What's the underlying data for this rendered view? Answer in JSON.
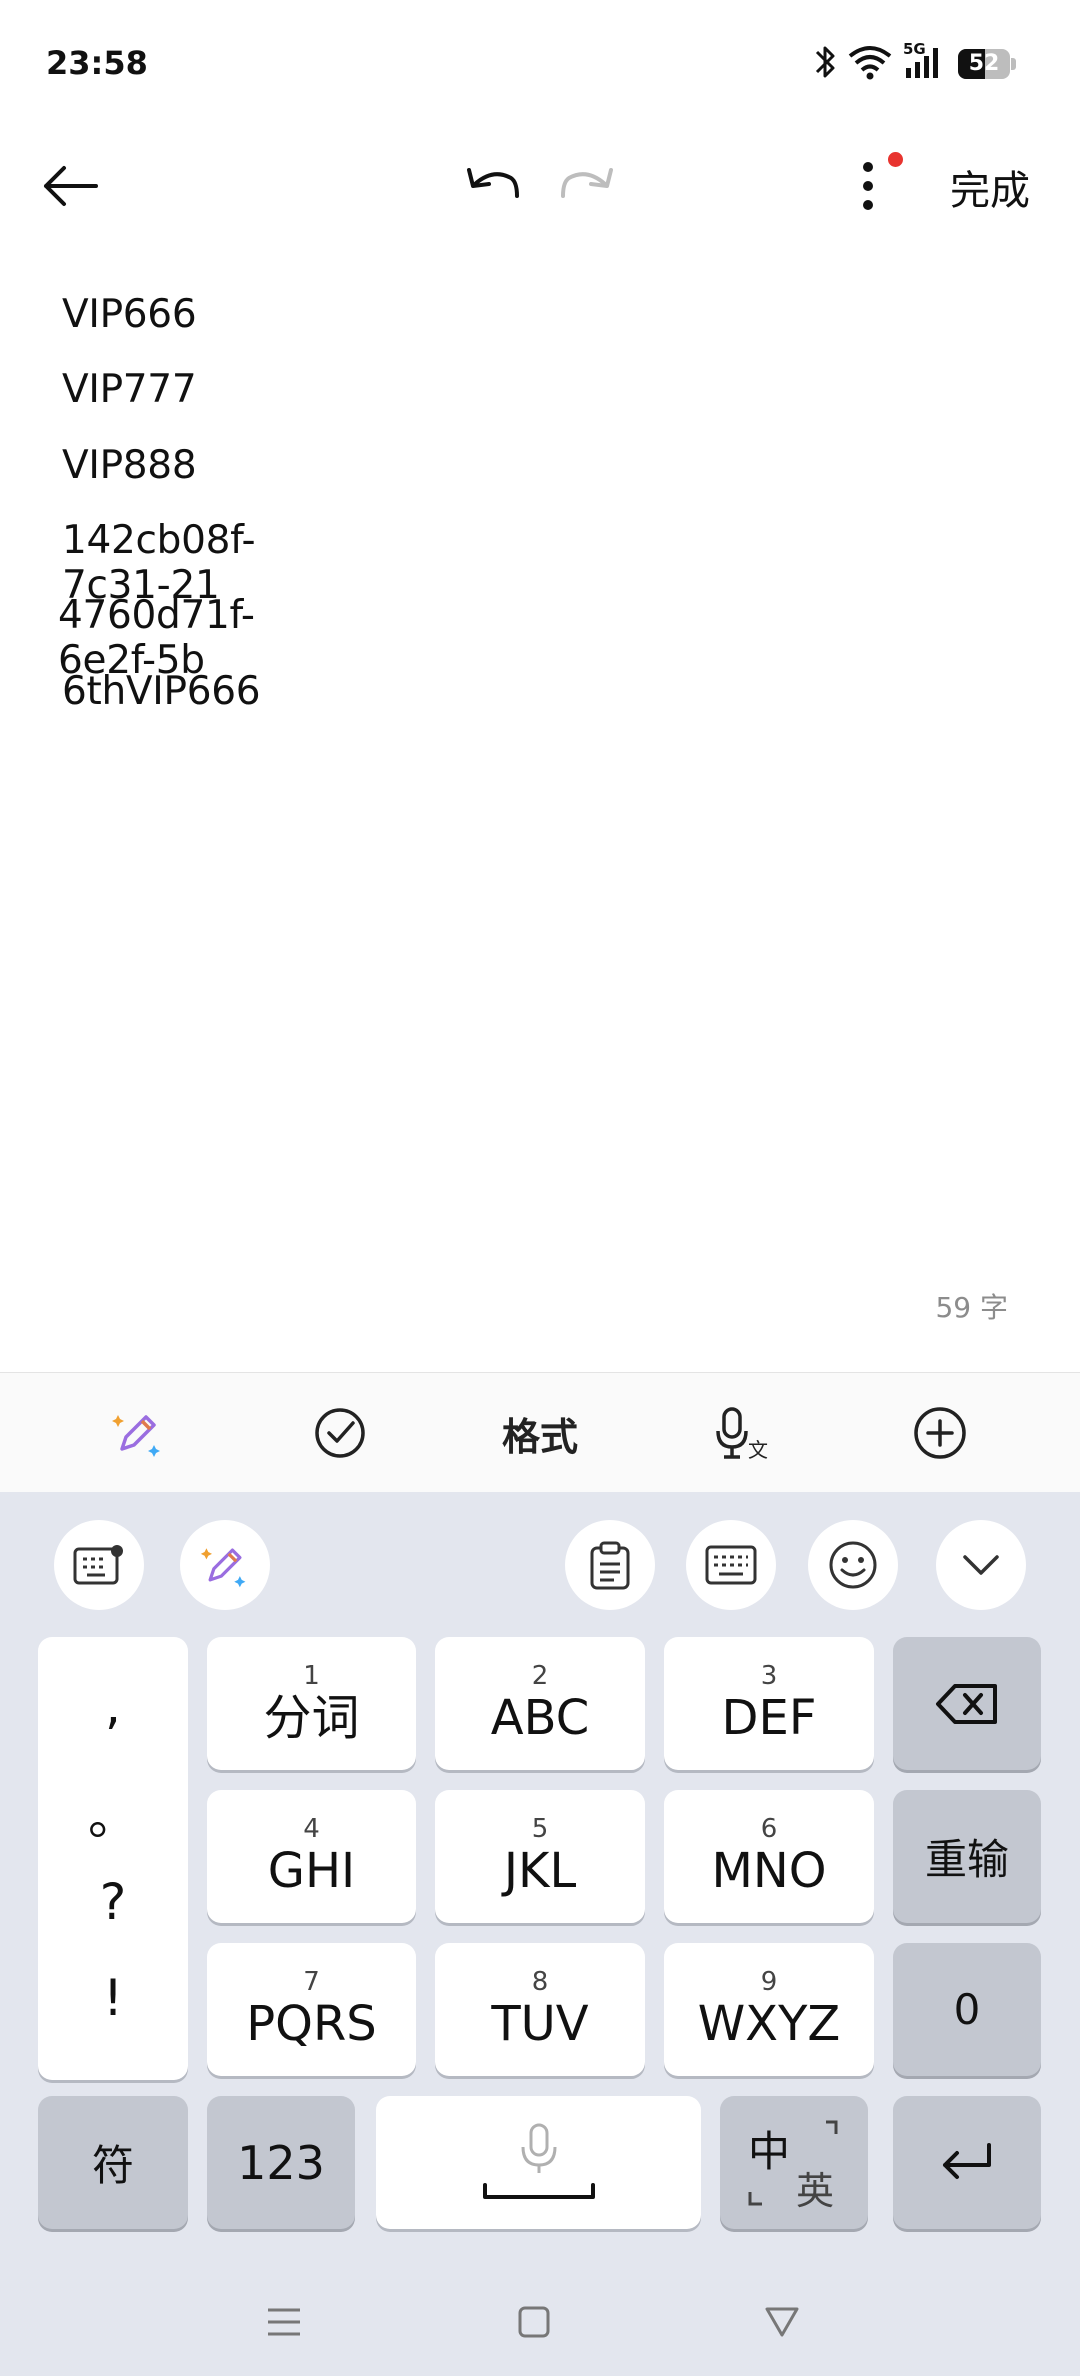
{
  "status_bar": {
    "time": "23:58",
    "network": "5G",
    "battery_level": "52",
    "battery_fraction": 0.52,
    "icons": [
      "bluetooth-icon",
      "wifi-icon",
      "signal-icon",
      "battery-icon"
    ]
  },
  "header": {
    "done_label": "完成",
    "icons": [
      "back-arrow-icon",
      "undo-icon",
      "redo-icon",
      "more-vertical-icon"
    ],
    "notification_dot_color": "#e8342f"
  },
  "note": {
    "lines": [
      "VIP666",
      "VIP777",
      "VIP888",
      "142cb08f-7c31-21",
      "4760d71f-6e2f-5b",
      "6thVIP666"
    ],
    "char_count": "59 字"
  },
  "toolbar": {
    "format_label": "格式",
    "icons": [
      "ai-pen-icon",
      "checklist-icon",
      "voice-to-text-icon",
      "add-circle-icon"
    ]
  },
  "keyboard": {
    "top_row_icons": [
      "keyboard-settings-icon",
      "ai-pen-icon",
      "clipboard-icon",
      "keyboard-layout-icon",
      "emoji-icon",
      "collapse-icon"
    ],
    "punct": [
      ",",
      "。",
      "?",
      "!"
    ],
    "keys": [
      {
        "num": "1",
        "label": "分词"
      },
      {
        "num": "2",
        "label": "ABC"
      },
      {
        "num": "3",
        "label": "DEF"
      },
      {
        "num": "4",
        "label": "GHI"
      },
      {
        "num": "5",
        "label": "JKL"
      },
      {
        "num": "6",
        "label": "MNO"
      },
      {
        "num": "7",
        "label": "PQRS"
      },
      {
        "num": "8",
        "label": "TUV"
      },
      {
        "num": "9",
        "label": "WXYZ"
      }
    ],
    "reenter_label": "重输",
    "zero_label": "0",
    "symbols_label": "符",
    "numbers_label": "123",
    "lang_primary": "中",
    "lang_secondary": "英"
  },
  "nav_bar": {
    "icons": [
      "menu-icon",
      "home-square-icon",
      "back-triangle-icon"
    ]
  }
}
